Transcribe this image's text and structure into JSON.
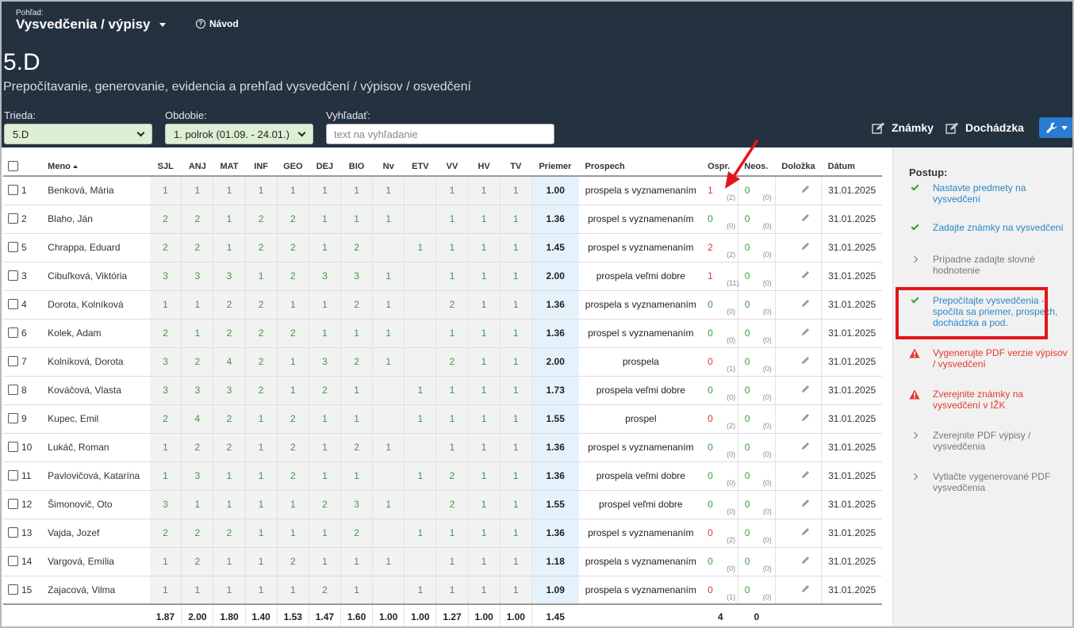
{
  "header": {
    "view_label": "Pohľad:",
    "view_title": "Vysvedčenia / výpisy",
    "help_label": "Návod",
    "class_title": "5.D",
    "subtitle": "Prepočítavanie, generovanie, evidencia a prehľad vysvedčení / výpisov / osvedčení"
  },
  "filters": {
    "class_label": "Trieda:",
    "class_value": "5.D",
    "period_label": "Obdobie:",
    "period_value": "1. polrok (01.09. - 24.01.)",
    "search_label": "Vyhľadať:",
    "search_placeholder": "text na vyhľadanie"
  },
  "toolbar": {
    "grades_label": "Známky",
    "attendance_label": "Dochádzka"
  },
  "table": {
    "headers": {
      "name": "Meno",
      "subjects": [
        "SJL",
        "ANJ",
        "MAT",
        "INF",
        "GEO",
        "DEJ",
        "BIO",
        "Nv",
        "ETV",
        "VV",
        "HV",
        "TV"
      ],
      "average": "Priemer",
      "result": "Prospech",
      "excused": "Ospr.",
      "unexcused": "Neos.",
      "attachment": "Doložka",
      "date": "Dátum"
    },
    "rows": [
      {
        "num": "1",
        "name": "Benková, Mária",
        "grades": [
          "1",
          "1",
          "1",
          "1",
          "1",
          "1",
          "1",
          "1",
          "",
          "1",
          "1",
          "1"
        ],
        "avg": "1.00",
        "result": "prospela s vyznamenaním",
        "excused": "1",
        "excused_hours": "(2)",
        "unexcused": "0",
        "unexcused_hours": "(0)",
        "date": "31.01.2025"
      },
      {
        "num": "2",
        "name": "Blaho, Ján",
        "grades": [
          "2",
          "2",
          "1",
          "2",
          "2",
          "1",
          "1",
          "1",
          "",
          "1",
          "1",
          "1"
        ],
        "avg": "1.36",
        "result": "prospel s vyznamenaním",
        "excused": "0",
        "excused_hours": "(0)",
        "unexcused": "0",
        "unexcused_hours": "(0)",
        "date": "31.01.2025"
      },
      {
        "num": "5",
        "name": "Chrappa, Eduard",
        "grades": [
          "2",
          "2",
          "1",
          "2",
          "2",
          "1",
          "2",
          "",
          "1",
          "1",
          "1",
          "1"
        ],
        "avg": "1.45",
        "result": "prospel s vyznamenaním",
        "excused": "2",
        "excused_hours": "(2)",
        "unexcused": "0",
        "unexcused_hours": "(0)",
        "date": "31.01.2025"
      },
      {
        "num": "3",
        "name": "Cibuľková, Viktória",
        "grades": [
          "3",
          "3",
          "3",
          "1",
          "2",
          "3",
          "3",
          "1",
          "",
          "1",
          "1",
          "1"
        ],
        "avg": "2.00",
        "result": "prospela veľmi dobre",
        "excused": "1",
        "excused_hours": "(11)",
        "unexcused": "0",
        "unexcused_hours": "(0)",
        "date": "31.01.2025"
      },
      {
        "num": "4",
        "name": "Dorota, Kolníková",
        "grades": [
          "1",
          "1",
          "2",
          "2",
          "1",
          "1",
          "2",
          "1",
          "",
          "2",
          "1",
          "1"
        ],
        "avg": "1.36",
        "result": "prospela s vyznamenaním",
        "excused": "0",
        "excused_hours": "(0)",
        "unexcused": "0",
        "unexcused_hours": "(0)",
        "date": "31.01.2025"
      },
      {
        "num": "6",
        "name": "Kolek, Adam",
        "grades": [
          "2",
          "1",
          "2",
          "2",
          "2",
          "1",
          "1",
          "1",
          "",
          "1",
          "1",
          "1"
        ],
        "avg": "1.36",
        "result": "prospel s vyznamenaním",
        "excused": "0",
        "excused_hours": "(0)",
        "unexcused": "0",
        "unexcused_hours": "(0)",
        "date": "31.01.2025"
      },
      {
        "num": "7",
        "name": "Kolníková, Dorota",
        "grades": [
          "3",
          "2",
          "4",
          "2",
          "1",
          "3",
          "2",
          "1",
          "",
          "2",
          "1",
          "1"
        ],
        "avg": "2.00",
        "result": "prospela",
        "excused": "0",
        "excused_hours": "(1)",
        "unexcused": "0",
        "unexcused_hours": "(0)",
        "date": "31.01.2025"
      },
      {
        "num": "8",
        "name": "Kováčová, Vlasta",
        "grades": [
          "3",
          "3",
          "3",
          "2",
          "1",
          "2",
          "1",
          "",
          "1",
          "1",
          "1",
          "1"
        ],
        "avg": "1.73",
        "result": "prospela veľmi dobre",
        "excused": "0",
        "excused_hours": "(0)",
        "unexcused": "0",
        "unexcused_hours": "(0)",
        "date": "31.01.2025"
      },
      {
        "num": "9",
        "name": "Kupec, Emil",
        "grades": [
          "2",
          "4",
          "2",
          "1",
          "2",
          "1",
          "1",
          "",
          "1",
          "1",
          "1",
          "1"
        ],
        "avg": "1.55",
        "result": "prospel",
        "excused": "0",
        "excused_hours": "(2)",
        "unexcused": "0",
        "unexcused_hours": "(0)",
        "date": "31.01.2025"
      },
      {
        "num": "10",
        "name": "Lukáč, Roman",
        "grades": [
          "1",
          "2",
          "2",
          "1",
          "2",
          "1",
          "2",
          "1",
          "",
          "1",
          "1",
          "1"
        ],
        "avg": "1.36",
        "result": "prospel s vyznamenaním",
        "excused": "0",
        "excused_hours": "(0)",
        "unexcused": "0",
        "unexcused_hours": "(0)",
        "date": "31.01.2025"
      },
      {
        "num": "11",
        "name": "Pavlovičová, Katarína",
        "grades": [
          "1",
          "3",
          "1",
          "1",
          "2",
          "1",
          "1",
          "",
          "1",
          "2",
          "1",
          "1"
        ],
        "avg": "1.36",
        "result": "prospela veľmi dobre",
        "excused": "0",
        "excused_hours": "(0)",
        "unexcused": "0",
        "unexcused_hours": "(0)",
        "date": "31.01.2025"
      },
      {
        "num": "12",
        "name": "Šimonovič, Oto",
        "grades": [
          "3",
          "1",
          "1",
          "1",
          "1",
          "2",
          "3",
          "1",
          "",
          "2",
          "1",
          "1"
        ],
        "avg": "1.55",
        "result": "prospel veľmi dobre",
        "excused": "0",
        "excused_hours": "(0)",
        "unexcused": "0",
        "unexcused_hours": "(0)",
        "date": "31.01.2025"
      },
      {
        "num": "13",
        "name": "Vajda, Jozef",
        "grades": [
          "2",
          "2",
          "2",
          "1",
          "1",
          "1",
          "2",
          "",
          "1",
          "1",
          "1",
          "1"
        ],
        "avg": "1.36",
        "result": "prospel s vyznamenaním",
        "excused": "0",
        "excused_hours": "(2)",
        "unexcused": "0",
        "unexcused_hours": "(0)",
        "date": "31.01.2025"
      },
      {
        "num": "14",
        "name": "Vargová, Emília",
        "grades": [
          "1",
          "2",
          "1",
          "1",
          "2",
          "1",
          "1",
          "1",
          "",
          "1",
          "1",
          "1"
        ],
        "avg": "1.18",
        "result": "prospela s vyznamenaním",
        "excused": "0",
        "excused_hours": "(0)",
        "unexcused": "0",
        "unexcused_hours": "(0)",
        "date": "31.01.2025"
      },
      {
        "num": "15",
        "name": "Zajacová, Vilma",
        "grades": [
          "1",
          "1",
          "1",
          "1",
          "1",
          "2",
          "1",
          "",
          "1",
          "1",
          "1",
          "1"
        ],
        "avg": "1.09",
        "result": "prospela s vyznamenaním",
        "excused": "0",
        "excused_hours": "(1)",
        "unexcused": "0",
        "unexcused_hours": "(0)",
        "date": "31.01.2025"
      }
    ],
    "totals": {
      "subjects": [
        "1.87",
        "2.00",
        "1.80",
        "1.40",
        "1.53",
        "1.47",
        "1.60",
        "1.00",
        "1.00",
        "1.27",
        "1.00",
        "1.00"
      ],
      "average": "1.45",
      "excused": "4",
      "unexcused": "0"
    }
  },
  "sidebar": {
    "title": "Postup:",
    "steps": [
      {
        "status": "done",
        "icon": "check-icon",
        "text": "Nastavte predmety na vysvedčení"
      },
      {
        "status": "done",
        "icon": "check-icon",
        "text": "Zadajte známky na vysvedčení"
      },
      {
        "status": "todo",
        "icon": "chevron-right-icon",
        "text": "Prípadne zadajte slovné hodnotenie"
      },
      {
        "status": "done",
        "icon": "check-icon",
        "text": "Prepočítajte vysvedčenia - spočíta sa priemer, prospech, dochádzka a pod."
      },
      {
        "status": "warn",
        "icon": "warning-icon",
        "text": "Vygenerujte PDF verzie výpisov / vysvedčení"
      },
      {
        "status": "warn",
        "icon": "warning-icon",
        "text": "Zverejnite známky na vysvedčení v IŽK"
      },
      {
        "status": "todo",
        "icon": "chevron-right-icon",
        "text": "Zverejnite PDF výpisy / vysvedčenia"
      },
      {
        "status": "todo",
        "icon": "chevron-right-icon",
        "text": "Vytlačte vygenerované PDF vysvedčenia"
      }
    ]
  },
  "colors": {
    "header_bg": "#24313f",
    "grade_green": "#3a9b3a",
    "link_blue": "#2a86c8",
    "warning_red": "#e23b2e",
    "highlight_red": "#e5141a",
    "average_bg": "#e6f2fb",
    "tools_button_blue": "#2a7bd2"
  }
}
